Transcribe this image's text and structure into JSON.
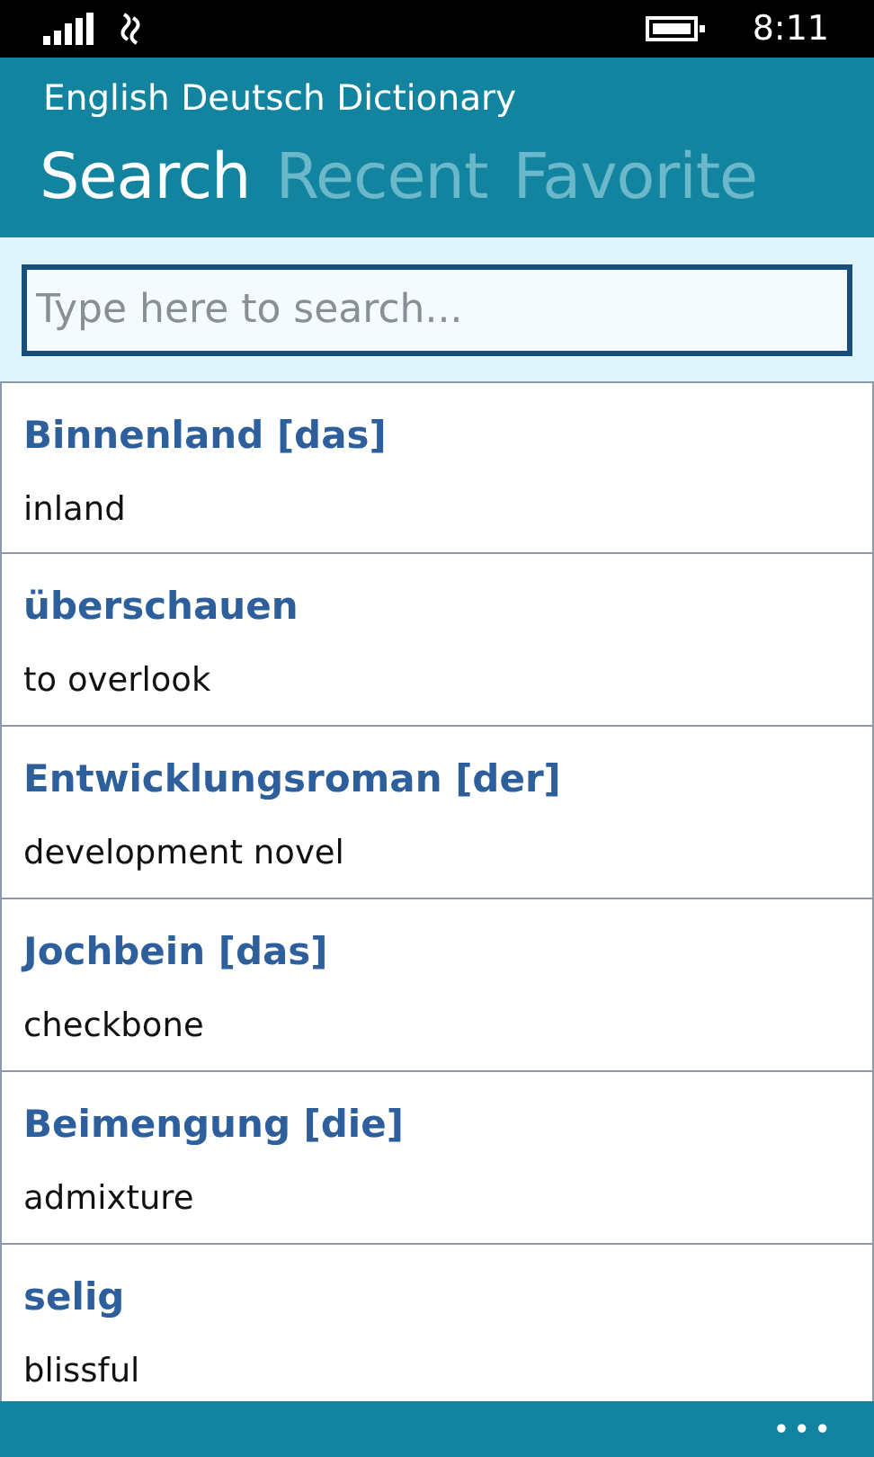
{
  "status_bar": {
    "time": "8:11"
  },
  "app": {
    "title": "English Deutsch Dictionary"
  },
  "tabs": [
    {
      "label": "Search",
      "selected": true
    },
    {
      "label": "Recent",
      "selected": false
    },
    {
      "label": "Favorite",
      "selected": false
    }
  ],
  "search": {
    "placeholder": "Type here to search..."
  },
  "entries": [
    {
      "word": "Binnenland [das]",
      "translation": "inland"
    },
    {
      "word": "überschauen",
      "translation": "to overlook"
    },
    {
      "word": "Entwicklungsroman [der]",
      "translation": "development novel"
    },
    {
      "word": "Jochbein [das]",
      "translation": "checkbone"
    },
    {
      "word": "Beimengung [die]",
      "translation": "admixture"
    },
    {
      "word": "selig",
      "translation": "blissful"
    }
  ],
  "app_bar": {
    "more": "•••"
  }
}
